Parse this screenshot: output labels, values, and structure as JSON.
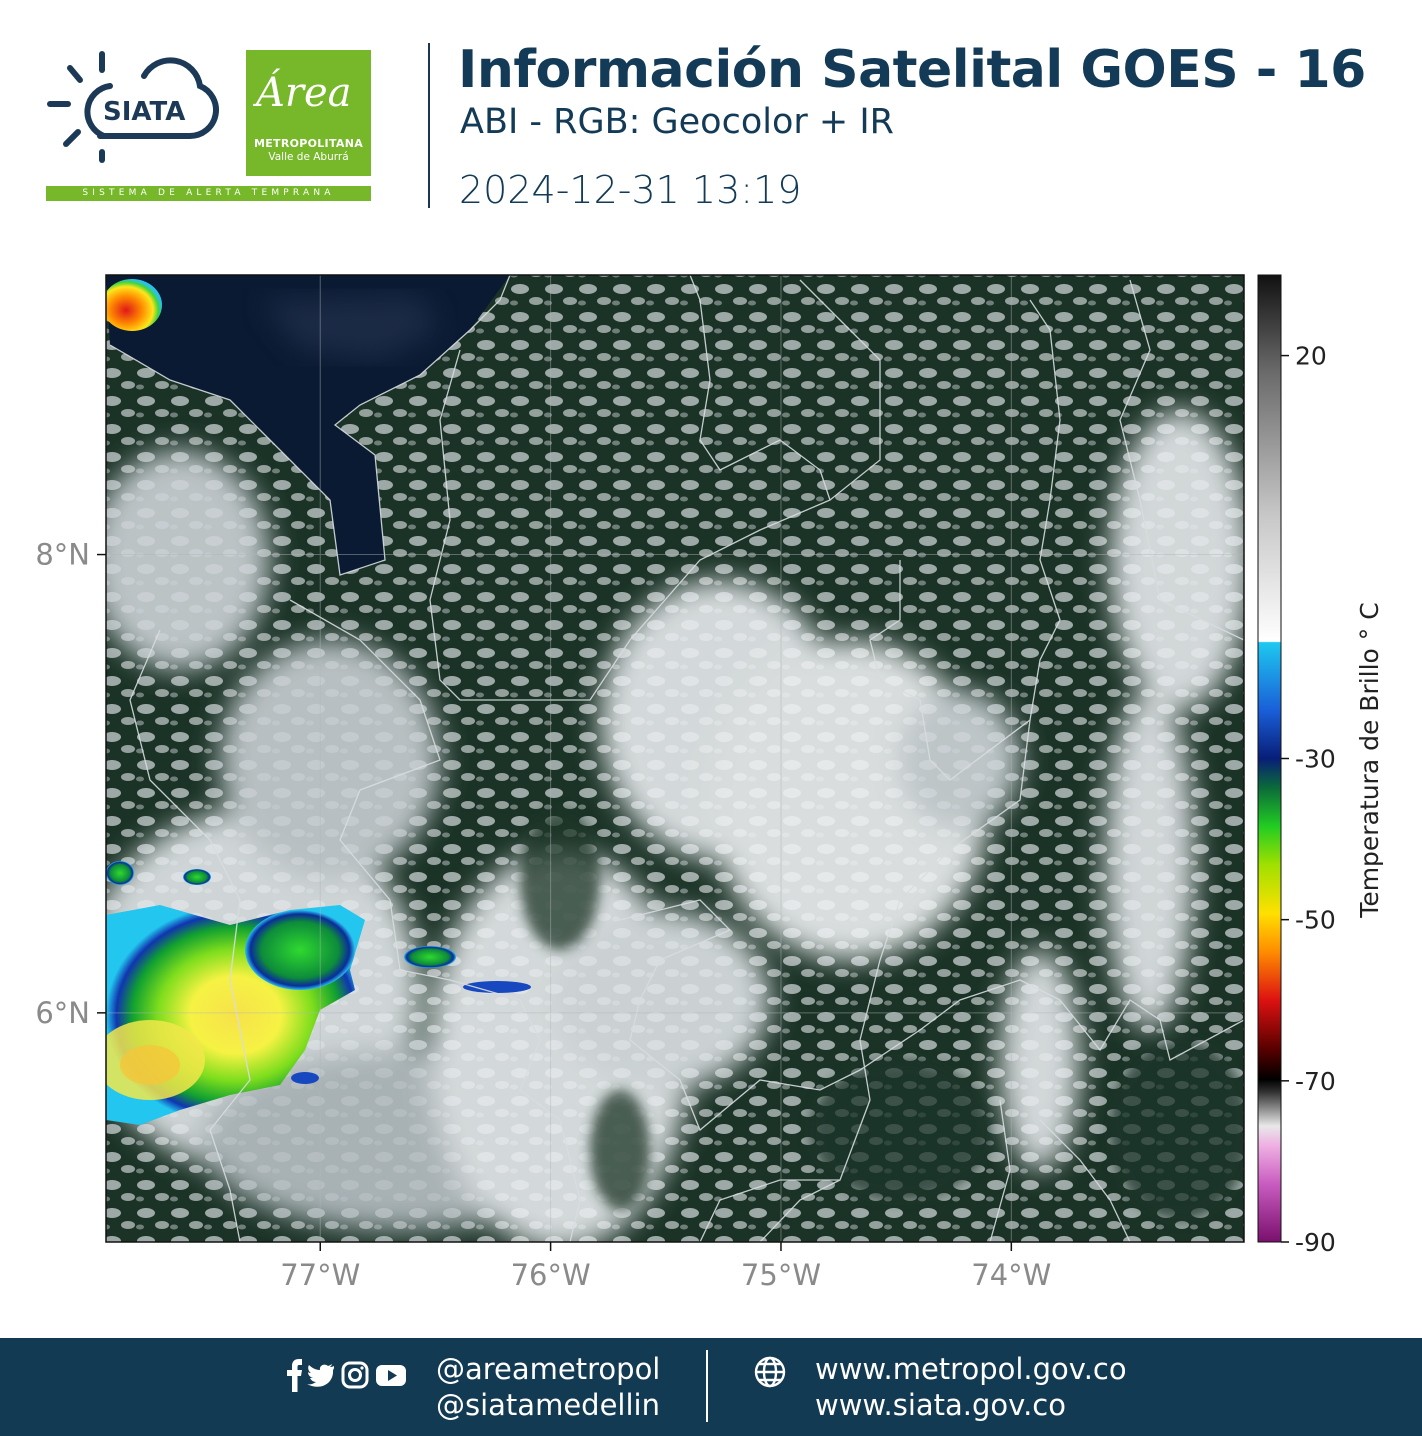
{
  "header": {
    "siata_logo_text": "SIATA",
    "area_logo": {
      "script": "Área",
      "line1": "METROPOLITANA",
      "line2": "Valle de Aburrá"
    },
    "siata_tagline": "SISTEMA DE ALERTA TEMPRANA",
    "title": "Información Satelital GOES - 16",
    "subtitle": "ABI - RGB: Geocolor + IR",
    "datetime": "2024-12-31 13:19"
  },
  "map": {
    "lat_ticks": [
      {
        "label": "8°N",
        "value": 8
      },
      {
        "label": "6°N",
        "value": 6
      }
    ],
    "lon_ticks": [
      {
        "label": "77°W",
        "value": -77
      },
      {
        "label": "76°W",
        "value": -76
      },
      {
        "label": "75°W",
        "value": -75
      },
      {
        "label": "74°W",
        "value": -74
      }
    ],
    "extent": {
      "lon_min": -77.93,
      "lon_max": -72.99,
      "lat_min": 5.0,
      "lat_max": 9.22
    },
    "grid": true
  },
  "colorbar": {
    "label": "Temperatura de Brillo ° C",
    "range": [
      -90,
      30
    ],
    "ticks": [
      {
        "label": "20",
        "value": 20
      },
      {
        "label": "-30",
        "value": -30
      },
      {
        "label": "-50",
        "value": -50
      },
      {
        "label": "-70",
        "value": -70
      },
      {
        "label": "-90",
        "value": -90
      }
    ]
  },
  "footer": {
    "icons": [
      "facebook-icon",
      "twitter-icon",
      "instagram-icon",
      "youtube-icon"
    ],
    "handle1": "@areametropol",
    "handle2": "@siatamedellin",
    "url1": "www.metropol.gov.co",
    "url2": "www.siata.gov.co"
  },
  "colors": {
    "brand_navy": "#133a53",
    "brand_green": "#76b82a"
  }
}
